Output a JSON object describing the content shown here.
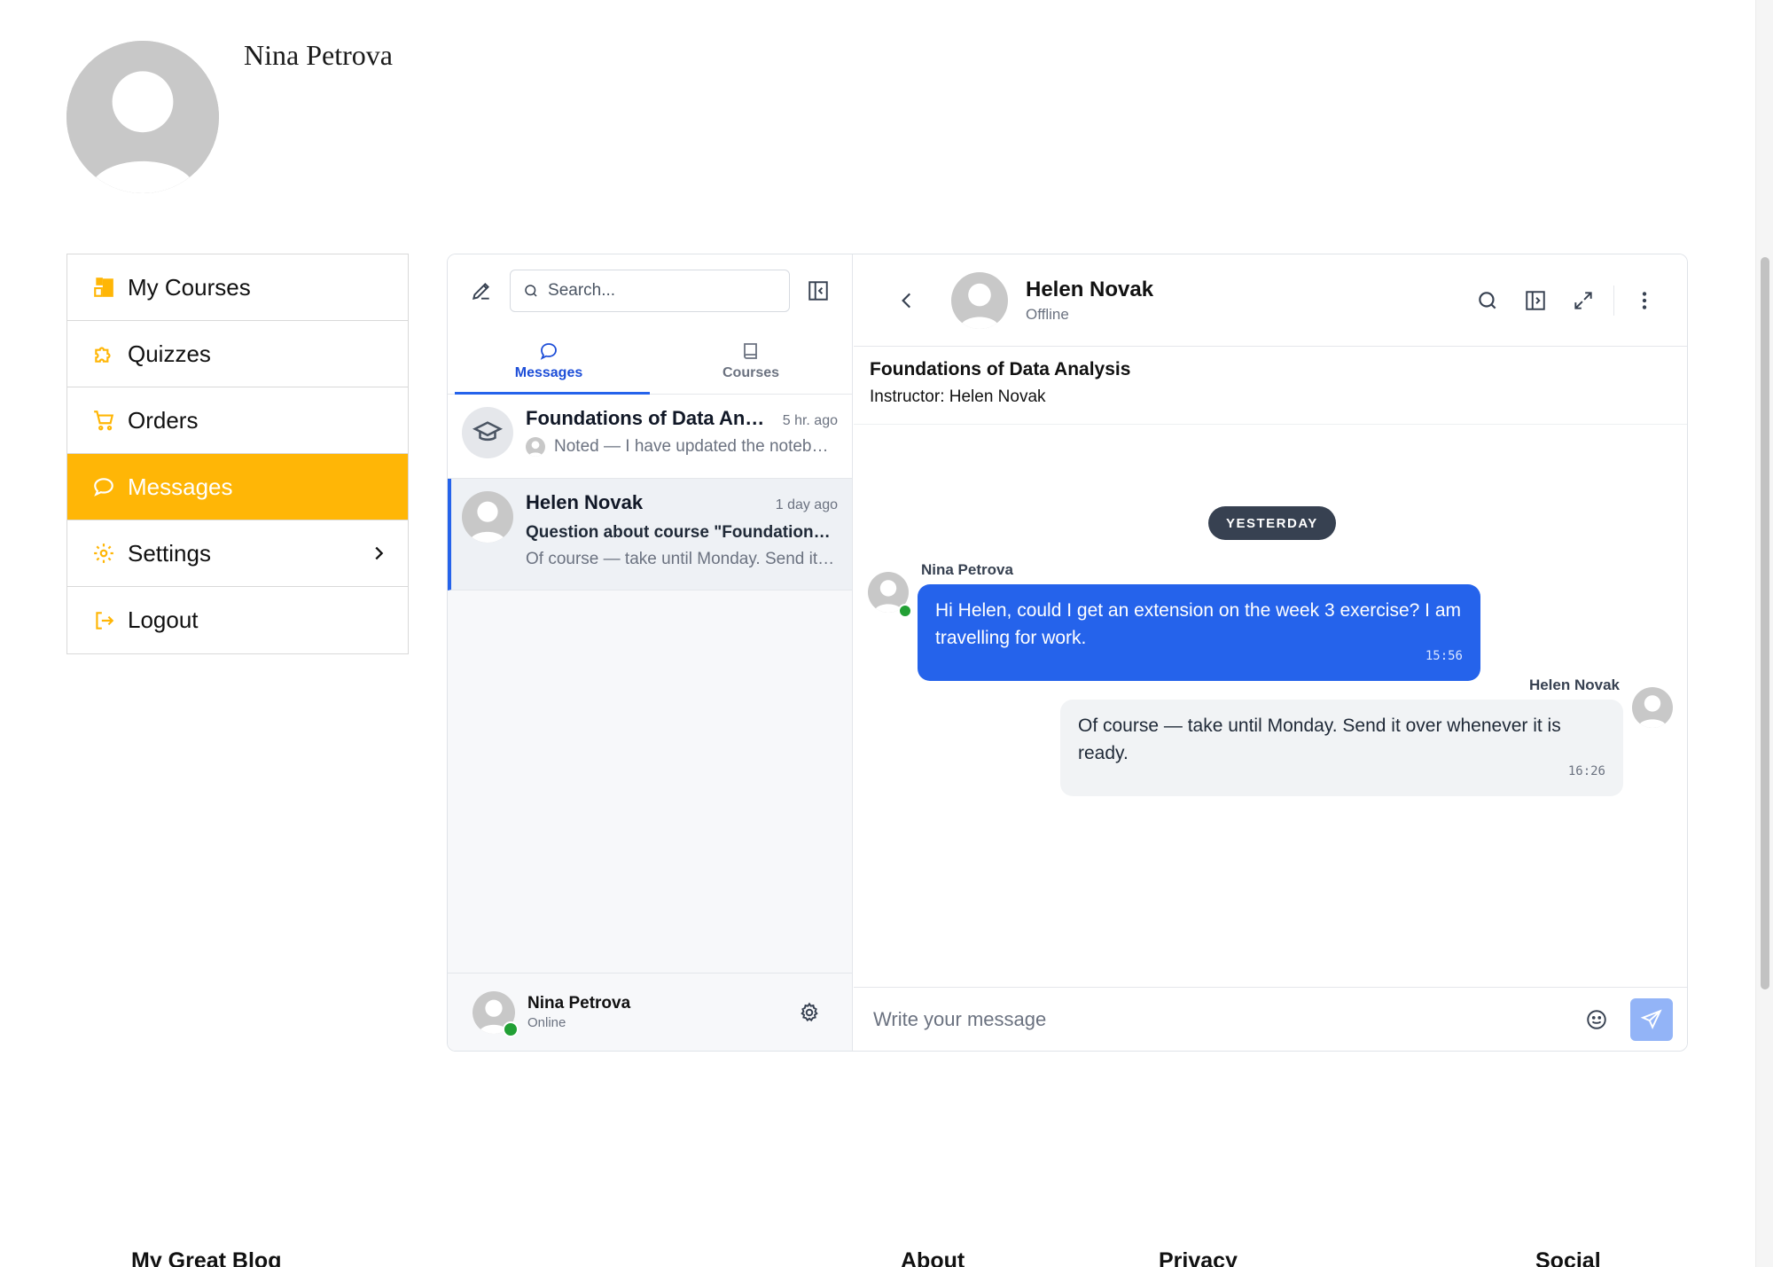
{
  "profile": {
    "name": "Nina Petrova"
  },
  "nav": {
    "items": [
      {
        "label": "My Courses",
        "icon": "courses-icon"
      },
      {
        "label": "Quizzes",
        "icon": "puzzle-icon"
      },
      {
        "label": "Orders",
        "icon": "cart-icon"
      },
      {
        "label": "Messages",
        "icon": "chat-icon",
        "active": true
      },
      {
        "label": "Settings",
        "icon": "gear-icon"
      },
      {
        "label": "Logout",
        "icon": "logout-icon"
      }
    ]
  },
  "messenger": {
    "search_placeholder": "Search...",
    "tabs": [
      {
        "label": "Messages",
        "active": true
      },
      {
        "label": "Courses"
      }
    ],
    "conversations": [
      {
        "title": "Foundations of Data Analysis",
        "time": "5 hr. ago",
        "preview": "Noted — I have updated the notebook."
      },
      {
        "title": "Helen Novak",
        "time": "1 day ago",
        "subject": "Question about course \"Foundations of Data Analysis\"",
        "preview": "Of course — take until Monday. Send it over whenever it is ready."
      }
    ],
    "me": {
      "name": "Nina Petrova",
      "status": "Online"
    },
    "chat": {
      "contact_name": "Helen Novak",
      "contact_status": "Offline",
      "course_title": "Foundations of Data Analysis",
      "course_instructor": "Instructor: Helen Novak",
      "day_label": "YESTERDAY",
      "messages": [
        {
          "sender": "Nina Petrova",
          "text": "Hi Helen, could I get an extension on the week 3 exercise? I am travelling for work.",
          "time": "15:56"
        },
        {
          "sender": "Helen Novak",
          "text": "Of course — take until Monday. Send it over whenever it is ready.",
          "time": "16:26"
        }
      ],
      "composer_placeholder": "Write your message"
    }
  },
  "footer": {
    "columns": [
      "My Great Blog",
      "About",
      "Privacy",
      "Social"
    ]
  },
  "colors": {
    "accent": "#ffb606",
    "primary": "#2563eb",
    "online": "#22a035"
  }
}
